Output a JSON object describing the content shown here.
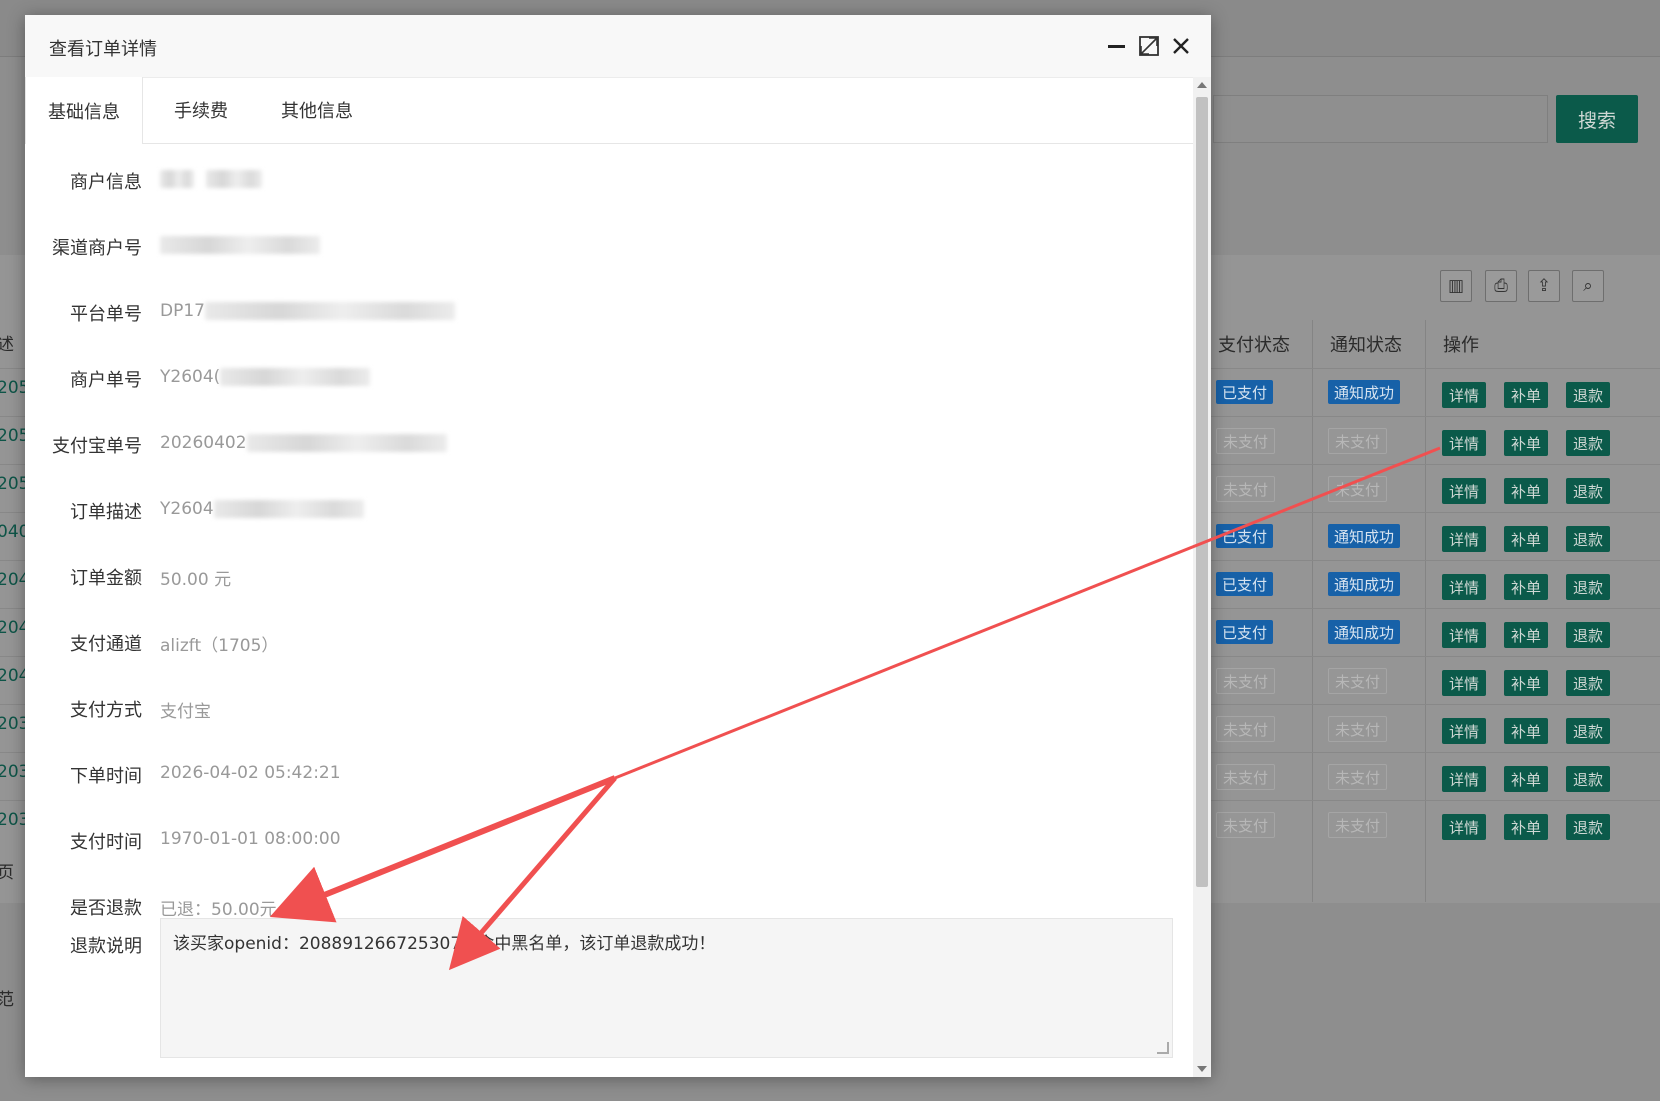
{
  "background": {
    "search_button": "搜索",
    "table_headers": {
      "pay_status": "支付状态",
      "notify_status": "通知状态",
      "actions": "操作"
    },
    "left_cut_texts": [
      "述",
      "205",
      "205",
      "205",
      "040",
      "204",
      "204",
      "204",
      "203",
      "203",
      "203",
      "页",
      "范"
    ],
    "rows": [
      {
        "pay": "已支付",
        "pay_kind": "paid",
        "notify": "通知成功",
        "notify_kind": "ok"
      },
      {
        "pay": "未支付",
        "pay_kind": "unpaid",
        "notify": "未支付",
        "notify_kind": "none"
      },
      {
        "pay": "未支付",
        "pay_kind": "unpaid",
        "notify": "未支付",
        "notify_kind": "none"
      },
      {
        "pay": "已支付",
        "pay_kind": "paid",
        "notify": "通知成功",
        "notify_kind": "ok"
      },
      {
        "pay": "已支付",
        "pay_kind": "paid",
        "notify": "通知成功",
        "notify_kind": "ok"
      },
      {
        "pay": "已支付",
        "pay_kind": "paid",
        "notify": "通知成功",
        "notify_kind": "ok"
      },
      {
        "pay": "未支付",
        "pay_kind": "unpaid",
        "notify": "未支付",
        "notify_kind": "none"
      },
      {
        "pay": "未支付",
        "pay_kind": "unpaid",
        "notify": "未支付",
        "notify_kind": "none"
      },
      {
        "pay": "未支付",
        "pay_kind": "unpaid",
        "notify": "未支付",
        "notify_kind": "none"
      },
      {
        "pay": "未支付",
        "pay_kind": "unpaid",
        "notify": "未支付",
        "notify_kind": "none"
      }
    ],
    "op_labels": {
      "detail": "详情",
      "supplement": "补单",
      "refund": "退款"
    },
    "tool_icons": [
      "columns-icon",
      "print-icon",
      "export-icon",
      "search-icon"
    ]
  },
  "modal": {
    "title": "查看订单详情",
    "tabs": [
      "基础信息",
      "手续费",
      "其他信息"
    ],
    "fields": [
      {
        "label": "商户信息",
        "prefix": ""
      },
      {
        "label": "渠道商户号",
        "prefix": ""
      },
      {
        "label": "平台单号",
        "prefix": "DP17"
      },
      {
        "label": "商户单号",
        "prefix": "Y2604("
      },
      {
        "label": "支付宝单号",
        "prefix": "20260402"
      },
      {
        "label": "订单描述",
        "prefix": "Y2604"
      },
      {
        "label": "订单金额",
        "prefix": "50.00 元"
      },
      {
        "label": "支付通道",
        "prefix": "alizft（1705）"
      },
      {
        "label": "支付方式",
        "prefix": "支付宝"
      },
      {
        "label": "下单时间",
        "prefix": "2026-04-02 05:42:21"
      },
      {
        "label": "支付时间",
        "prefix": "1970-01-01 08:00:00"
      },
      {
        "label": "是否退款",
        "prefix": "已退：50.00元"
      }
    ],
    "refund_label": "退款说明",
    "refund_text": "该买家openid：2088912667253072 命中黑名单，该订单退款成功！"
  },
  "colors": {
    "accent_green": "#0b5a4a",
    "badge_blue": "#1761a8",
    "arrow_red": "#f05050"
  }
}
